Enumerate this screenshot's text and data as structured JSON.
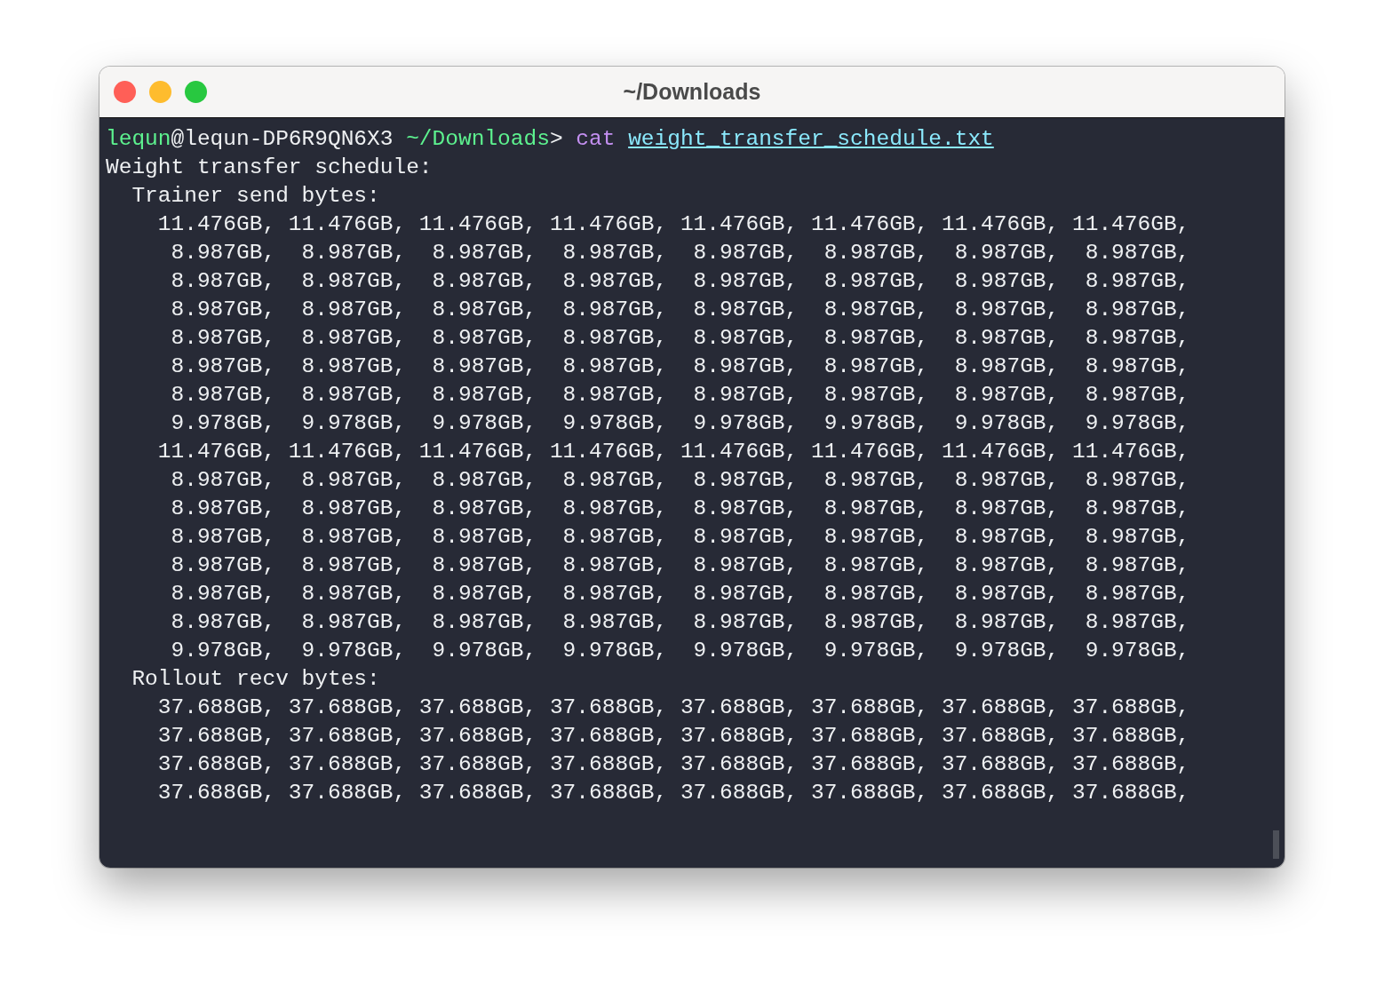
{
  "window": {
    "title": "~/Downloads"
  },
  "prompt": {
    "user": "lequn",
    "host": "@lequn-DP6R9QN6X3",
    "path": "~/Downloads",
    "symbol": ">",
    "command": "cat",
    "argument": "weight_transfer_schedule.txt"
  },
  "output": [
    "Weight transfer schedule:",
    "  Trainer send bytes:",
    "    11.476GB, 11.476GB, 11.476GB, 11.476GB, 11.476GB, 11.476GB, 11.476GB, 11.476GB,",
    "     8.987GB,  8.987GB,  8.987GB,  8.987GB,  8.987GB,  8.987GB,  8.987GB,  8.987GB,",
    "     8.987GB,  8.987GB,  8.987GB,  8.987GB,  8.987GB,  8.987GB,  8.987GB,  8.987GB,",
    "     8.987GB,  8.987GB,  8.987GB,  8.987GB,  8.987GB,  8.987GB,  8.987GB,  8.987GB,",
    "     8.987GB,  8.987GB,  8.987GB,  8.987GB,  8.987GB,  8.987GB,  8.987GB,  8.987GB,",
    "     8.987GB,  8.987GB,  8.987GB,  8.987GB,  8.987GB,  8.987GB,  8.987GB,  8.987GB,",
    "     8.987GB,  8.987GB,  8.987GB,  8.987GB,  8.987GB,  8.987GB,  8.987GB,  8.987GB,",
    "     9.978GB,  9.978GB,  9.978GB,  9.978GB,  9.978GB,  9.978GB,  9.978GB,  9.978GB,",
    "    11.476GB, 11.476GB, 11.476GB, 11.476GB, 11.476GB, 11.476GB, 11.476GB, 11.476GB,",
    "     8.987GB,  8.987GB,  8.987GB,  8.987GB,  8.987GB,  8.987GB,  8.987GB,  8.987GB,",
    "     8.987GB,  8.987GB,  8.987GB,  8.987GB,  8.987GB,  8.987GB,  8.987GB,  8.987GB,",
    "     8.987GB,  8.987GB,  8.987GB,  8.987GB,  8.987GB,  8.987GB,  8.987GB,  8.987GB,",
    "     8.987GB,  8.987GB,  8.987GB,  8.987GB,  8.987GB,  8.987GB,  8.987GB,  8.987GB,",
    "     8.987GB,  8.987GB,  8.987GB,  8.987GB,  8.987GB,  8.987GB,  8.987GB,  8.987GB,",
    "     8.987GB,  8.987GB,  8.987GB,  8.987GB,  8.987GB,  8.987GB,  8.987GB,  8.987GB,",
    "     9.978GB,  9.978GB,  9.978GB,  9.978GB,  9.978GB,  9.978GB,  9.978GB,  9.978GB,",
    "  Rollout recv bytes:",
    "    37.688GB, 37.688GB, 37.688GB, 37.688GB, 37.688GB, 37.688GB, 37.688GB, 37.688GB,",
    "    37.688GB, 37.688GB, 37.688GB, 37.688GB, 37.688GB, 37.688GB, 37.688GB, 37.688GB,",
    "    37.688GB, 37.688GB, 37.688GB, 37.688GB, 37.688GB, 37.688GB, 37.688GB, 37.688GB,",
    "    37.688GB, 37.688GB, 37.688GB, 37.688GB, 37.688GB, 37.688GB, 37.688GB, 37.688GB,"
  ]
}
